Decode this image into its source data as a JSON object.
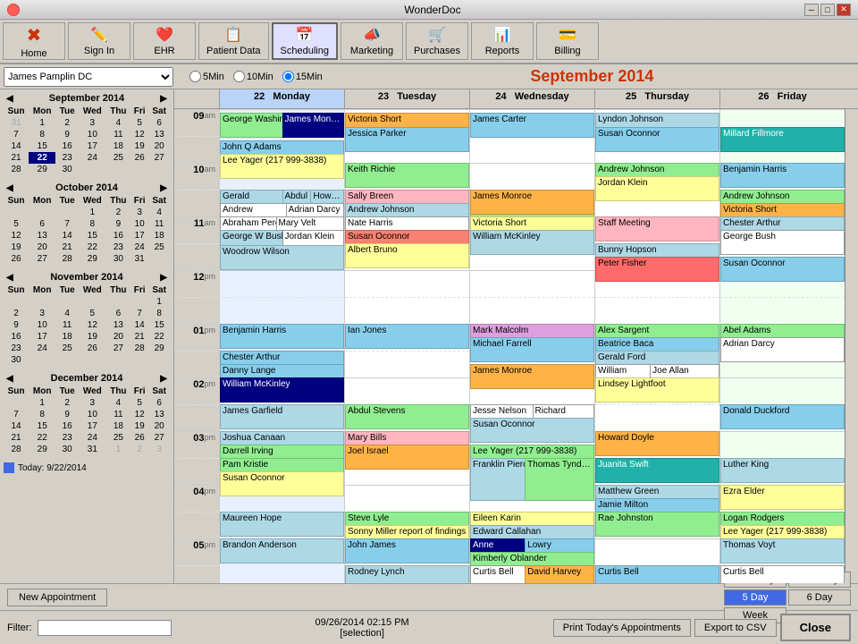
{
  "app": {
    "title": "WonderDoc",
    "close_btn": "✕",
    "minimize_btn": "─",
    "maximize_btn": "□"
  },
  "menu": {
    "items": [
      {
        "label": "Home",
        "icon": "🏠"
      },
      {
        "label": "Sign In",
        "icon": "✏️"
      },
      {
        "label": "EHR",
        "icon": "❤️"
      },
      {
        "label": "Patient Data",
        "icon": "📋"
      },
      {
        "label": "Scheduling",
        "icon": "📅"
      },
      {
        "label": "Marketing",
        "icon": "📣"
      },
      {
        "label": "Purchases",
        "icon": "🛒"
      },
      {
        "label": "Reports",
        "icon": "📊"
      },
      {
        "label": "Billing",
        "icon": "💳"
      }
    ]
  },
  "toolbar": {
    "doc_select": "James Pamplin DC",
    "radio_5": "5Min",
    "radio_10": "10Min",
    "radio_15": "15Min",
    "month_title": "September 2014"
  },
  "mini_cals": [
    {
      "month": "September 2014",
      "headers": [
        "Sun",
        "Mon",
        "Tue",
        "Wed",
        "Thu",
        "Fri",
        "Sat"
      ],
      "weeks": [
        [
          {
            "d": "31",
            "o": true
          },
          {
            "d": "1"
          },
          {
            "d": "2"
          },
          {
            "d": "3"
          },
          {
            "d": "4"
          },
          {
            "d": "5"
          },
          {
            "d": "6"
          }
        ],
        [
          {
            "d": "7"
          },
          {
            "d": "8"
          },
          {
            "d": "9"
          },
          {
            "d": "10"
          },
          {
            "d": "11"
          },
          {
            "d": "12"
          },
          {
            "d": "13"
          }
        ],
        [
          {
            "d": "14"
          },
          {
            "d": "15"
          },
          {
            "d": "16"
          },
          {
            "d": "17"
          },
          {
            "d": "18"
          },
          {
            "d": "19"
          },
          {
            "d": "20"
          }
        ],
        [
          {
            "d": "21"
          },
          {
            "d": "22",
            "sel": true
          },
          {
            "d": "23"
          },
          {
            "d": "24"
          },
          {
            "d": "25"
          },
          {
            "d": "26"
          },
          {
            "d": "27"
          }
        ],
        [
          {
            "d": "28"
          },
          {
            "d": "29"
          },
          {
            "d": "30"
          },
          {
            "d": "",
            "o": true
          },
          {
            "d": "",
            "o": true
          },
          {
            "d": "",
            "o": true
          },
          {
            "d": "",
            "o": true
          }
        ]
      ]
    },
    {
      "month": "October 2014",
      "headers": [
        "Sun",
        "Mon",
        "Tue",
        "Wed",
        "Thu",
        "Fri",
        "Sat"
      ],
      "weeks": [
        [
          {
            "d": ""
          },
          {
            "d": ""
          },
          {
            "d": ""
          },
          {
            "d": "1"
          },
          {
            "d": "2"
          },
          {
            "d": "3"
          },
          {
            "d": "4"
          }
        ],
        [
          {
            "d": "5"
          },
          {
            "d": "6"
          },
          {
            "d": "7"
          },
          {
            "d": "8"
          },
          {
            "d": "9"
          },
          {
            "d": "10"
          },
          {
            "d": "11"
          }
        ],
        [
          {
            "d": "12"
          },
          {
            "d": "13"
          },
          {
            "d": "14"
          },
          {
            "d": "15"
          },
          {
            "d": "16"
          },
          {
            "d": "17"
          },
          {
            "d": "18"
          }
        ],
        [
          {
            "d": "19"
          },
          {
            "d": "20"
          },
          {
            "d": "21"
          },
          {
            "d": "22"
          },
          {
            "d": "23"
          },
          {
            "d": "24"
          },
          {
            "d": "25"
          }
        ],
        [
          {
            "d": "26"
          },
          {
            "d": "27"
          },
          {
            "d": "28"
          },
          {
            "d": "29"
          },
          {
            "d": "30"
          },
          {
            "d": "31"
          },
          {
            "d": ""
          }
        ]
      ]
    },
    {
      "month": "November 2014",
      "headers": [
        "Sun",
        "Mon",
        "Tue",
        "Wed",
        "Thu",
        "Fri",
        "Sat"
      ],
      "weeks": [
        [
          {
            "d": ""
          },
          {
            "d": ""
          },
          {
            "d": ""
          },
          {
            "d": ""
          },
          {
            "d": ""
          },
          {
            "d": ""
          },
          {
            "d": "1"
          }
        ],
        [
          {
            "d": "2"
          },
          {
            "d": "3"
          },
          {
            "d": "4"
          },
          {
            "d": "5"
          },
          {
            "d": "6"
          },
          {
            "d": "7"
          },
          {
            "d": "8"
          }
        ],
        [
          {
            "d": "9"
          },
          {
            "d": "10"
          },
          {
            "d": "11"
          },
          {
            "d": "12"
          },
          {
            "d": "13"
          },
          {
            "d": "14"
          },
          {
            "d": "15"
          }
        ],
        [
          {
            "d": "16"
          },
          {
            "d": "17"
          },
          {
            "d": "18"
          },
          {
            "d": "19"
          },
          {
            "d": "20"
          },
          {
            "d": "21"
          },
          {
            "d": "22"
          }
        ],
        [
          {
            "d": "23"
          },
          {
            "d": "24"
          },
          {
            "d": "25"
          },
          {
            "d": "26"
          },
          {
            "d": "27"
          },
          {
            "d": "28"
          },
          {
            "d": "29"
          }
        ],
        [
          {
            "d": "30"
          },
          {
            "d": ""
          },
          {
            "d": ""
          },
          {
            "d": ""
          },
          {
            "d": ""
          },
          {
            "d": ""
          },
          {
            "d": ""
          }
        ]
      ]
    },
    {
      "month": "December 2014",
      "headers": [
        "Sun",
        "Mon",
        "Tue",
        "Wed",
        "Thu",
        "Fri",
        "Sat"
      ],
      "weeks": [
        [
          {
            "d": ""
          },
          {
            "d": "1"
          },
          {
            "d": "2"
          },
          {
            "d": "3"
          },
          {
            "d": "4"
          },
          {
            "d": "5"
          },
          {
            "d": "6"
          }
        ],
        [
          {
            "d": "7"
          },
          {
            "d": "8"
          },
          {
            "d": "9"
          },
          {
            "d": "10"
          },
          {
            "d": "11"
          },
          {
            "d": "12"
          },
          {
            "d": "13"
          }
        ],
        [
          {
            "d": "14"
          },
          {
            "d": "15"
          },
          {
            "d": "16"
          },
          {
            "d": "17"
          },
          {
            "d": "18"
          },
          {
            "d": "19"
          },
          {
            "d": "20"
          }
        ],
        [
          {
            "d": "21"
          },
          {
            "d": "22"
          },
          {
            "d": "23"
          },
          {
            "d": "24"
          },
          {
            "d": "25"
          },
          {
            "d": "26"
          },
          {
            "d": "27"
          }
        ],
        [
          {
            "d": "28"
          },
          {
            "d": "29"
          },
          {
            "d": "30"
          },
          {
            "d": "31"
          },
          {
            "d": "1",
            "o": true
          },
          {
            "d": "2",
            "o": true
          },
          {
            "d": "3",
            "o": true
          }
        ]
      ]
    }
  ],
  "today_label": "Today: 9/22/2014",
  "cal_header": {
    "days": [
      {
        "num": "22",
        "name": "Monday"
      },
      {
        "num": "23",
        "name": "Tuesday"
      },
      {
        "num": "24",
        "name": "Wednesday"
      },
      {
        "num": "25",
        "name": "Thursday"
      },
      {
        "num": "26",
        "name": "Friday"
      }
    ]
  },
  "time_slots": [
    {
      "hour": "09",
      "ampm": "am"
    },
    {
      "hour": "",
      "ampm": ""
    },
    {
      "hour": "10",
      "ampm": "am"
    },
    {
      "hour": "",
      "ampm": ""
    },
    {
      "hour": "11",
      "ampm": "am"
    },
    {
      "hour": "",
      "ampm": ""
    },
    {
      "hour": "12",
      "ampm": "pm"
    },
    {
      "hour": "",
      "ampm": ""
    },
    {
      "hour": "01",
      "ampm": "pm"
    },
    {
      "hour": "",
      "ampm": ""
    },
    {
      "hour": "02",
      "ampm": "pm"
    },
    {
      "hour": "",
      "ampm": ""
    },
    {
      "hour": "03",
      "ampm": "pm"
    },
    {
      "hour": "",
      "ampm": ""
    },
    {
      "hour": "04",
      "ampm": "pm"
    },
    {
      "hour": "",
      "ampm": ""
    },
    {
      "hour": "05",
      "ampm": "pm"
    },
    {
      "hour": "",
      "ampm": ""
    }
  ],
  "bottom": {
    "new_appt": "New Appointment",
    "selection": "09/26/2014 02:15 PM\n[selection]",
    "selection_line1": "09/26/2014 02:15 PM",
    "selection_line2": "[selection]",
    "view_btns": [
      "One Day",
      "Two Day",
      "5 Day",
      "6 Day",
      "Week"
    ],
    "active_view": "5 Day",
    "filter_label": "Filter:",
    "print_btn": "Print Today's Appointments",
    "export_btn": "Export to CSV",
    "close_btn": "Close"
  }
}
